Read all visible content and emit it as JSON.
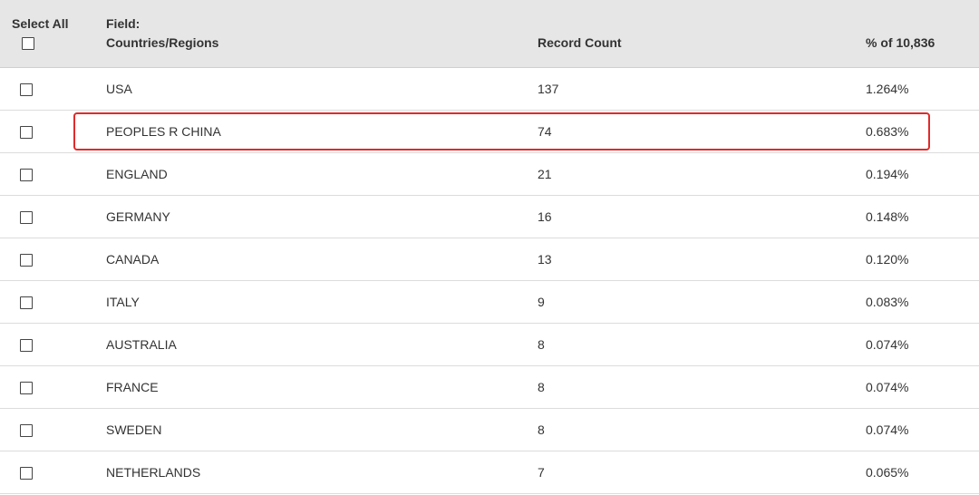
{
  "header": {
    "select_all_label": "Select All",
    "field_label": "Field:",
    "field_name": "Countries/Regions",
    "count_label": "Record Count",
    "percent_label": "% of 10,836"
  },
  "rows": [
    {
      "country": "USA",
      "count": "137",
      "percent": "1.264%"
    },
    {
      "country": "PEOPLES R CHINA",
      "count": "74",
      "percent": "0.683%"
    },
    {
      "country": "ENGLAND",
      "count": "21",
      "percent": "0.194%"
    },
    {
      "country": "GERMANY",
      "count": "16",
      "percent": "0.148%"
    },
    {
      "country": "CANADA",
      "count": "13",
      "percent": "0.120%"
    },
    {
      "country": "ITALY",
      "count": "9",
      "percent": "0.083%"
    },
    {
      "country": "AUSTRALIA",
      "count": "8",
      "percent": "0.074%"
    },
    {
      "country": "FRANCE",
      "count": "8",
      "percent": "0.074%"
    },
    {
      "country": "SWEDEN",
      "count": "8",
      "percent": "0.074%"
    },
    {
      "country": "NETHERLANDS",
      "count": "7",
      "percent": "0.065%"
    }
  ],
  "highlight": {
    "color": "#e02b2b",
    "row": "PEOPLES R CHINA"
  }
}
